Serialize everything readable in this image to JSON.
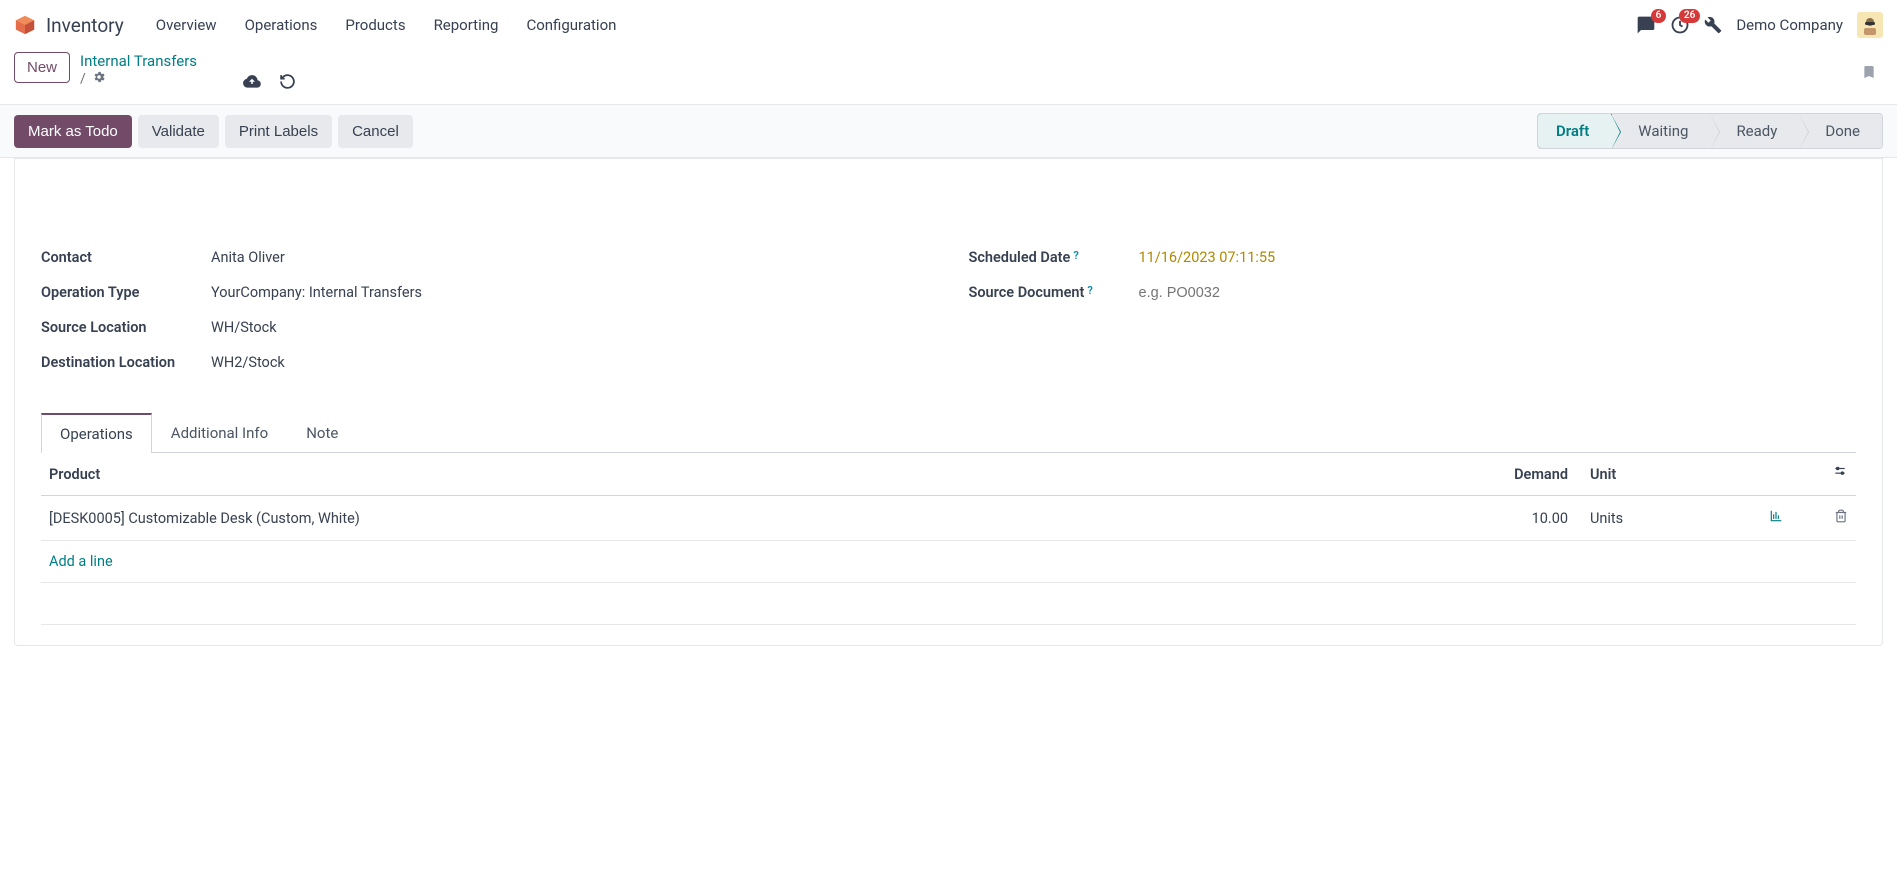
{
  "app": {
    "title": "Inventory"
  },
  "menu": {
    "overview": "Overview",
    "operations": "Operations",
    "products": "Products",
    "reporting": "Reporting",
    "configuration": "Configuration"
  },
  "systray": {
    "messages_count": "6",
    "activities_count": "26",
    "company": "Demo Company"
  },
  "breadcrumb": {
    "new_label": "New",
    "parent": "Internal Transfers",
    "separator": "/"
  },
  "actions": {
    "mark_todo": "Mark as Todo",
    "validate": "Validate",
    "print_labels": "Print Labels",
    "cancel": "Cancel"
  },
  "status": {
    "draft": "Draft",
    "waiting": "Waiting",
    "ready": "Ready",
    "done": "Done"
  },
  "form": {
    "labels": {
      "contact": "Contact",
      "operation_type": "Operation Type",
      "source_location": "Source Location",
      "destination_location": "Destination Location",
      "scheduled_date": "Scheduled Date",
      "source_document": "Source Document"
    },
    "values": {
      "contact": "Anita Oliver",
      "operation_type": "YourCompany: Internal Transfers",
      "source_location": "WH/Stock",
      "destination_location": "WH2/Stock",
      "scheduled_date": "11/16/2023 07:11:55",
      "source_document_placeholder": "e.g. PO0032"
    },
    "help": "?"
  },
  "tabs": {
    "operations": "Operations",
    "additional_info": "Additional Info",
    "note": "Note"
  },
  "table": {
    "headers": {
      "product": "Product",
      "demand": "Demand",
      "unit": "Unit"
    },
    "row0": {
      "product": "[DESK0005] Customizable Desk (Custom, White)",
      "demand": "10.00",
      "unit": "Units"
    },
    "add_line": "Add a line"
  }
}
